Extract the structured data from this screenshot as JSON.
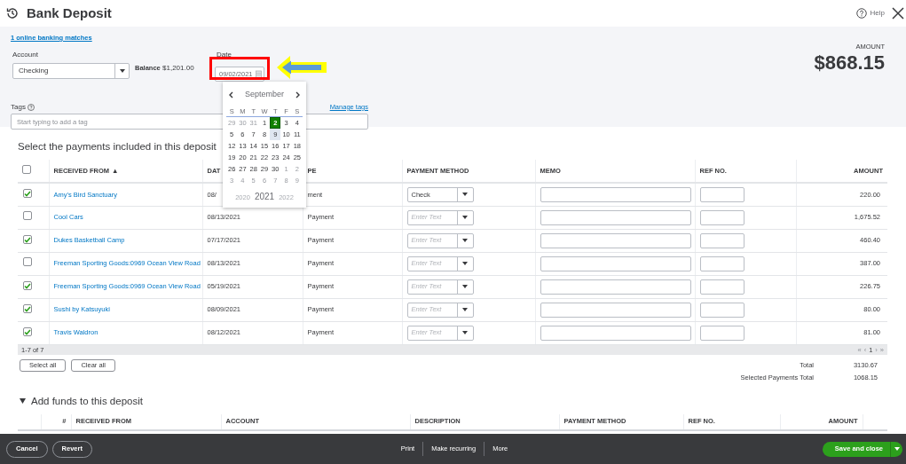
{
  "window": {
    "title": "Bank Deposit",
    "help": "Help"
  },
  "header": {
    "banking_matches": "1 online banking matches",
    "account": {
      "label": "Account",
      "value": "Checking"
    },
    "balance_label": "Balance",
    "balance_value": "$1,201.00",
    "date": {
      "label": "Date",
      "value": "09/02/2021"
    },
    "amount_label": "AMOUNT",
    "amount": "$868.15",
    "tags": {
      "label": "Tags",
      "placeholder": "Start typing to add a tag"
    },
    "manage_tags": "Manage tags"
  },
  "date_picker": {
    "month": "September",
    "weekdays": [
      "S",
      "M",
      "T",
      "W",
      "T",
      "F",
      "S"
    ],
    "weeks": [
      [
        {
          "day": "29",
          "muted": true,
          "selected": false,
          "highlighted": false
        },
        {
          "day": "30",
          "muted": true,
          "selected": false,
          "highlighted": false
        },
        {
          "day": "31",
          "muted": true,
          "selected": false,
          "highlighted": false
        },
        {
          "day": "1",
          "muted": false,
          "selected": false,
          "highlighted": false
        },
        {
          "day": "2",
          "muted": false,
          "selected": true,
          "highlighted": false
        },
        {
          "day": "3",
          "muted": false,
          "selected": false,
          "highlighted": false
        },
        {
          "day": "4",
          "muted": false,
          "selected": false,
          "highlighted": false
        }
      ],
      [
        {
          "day": "5",
          "muted": false,
          "selected": false,
          "highlighted": false
        },
        {
          "day": "6",
          "muted": false,
          "selected": false,
          "highlighted": false
        },
        {
          "day": "7",
          "muted": false,
          "selected": false,
          "highlighted": false
        },
        {
          "day": "8",
          "muted": false,
          "selected": false,
          "highlighted": false
        },
        {
          "day": "9",
          "muted": false,
          "selected": false,
          "highlighted": true
        },
        {
          "day": "10",
          "muted": false,
          "selected": false,
          "highlighted": false
        },
        {
          "day": "11",
          "muted": false,
          "selected": false,
          "highlighted": false
        }
      ],
      [
        {
          "day": "12",
          "muted": false,
          "selected": false,
          "highlighted": false
        },
        {
          "day": "13",
          "muted": false,
          "selected": false,
          "highlighted": false
        },
        {
          "day": "14",
          "muted": false,
          "selected": false,
          "highlighted": false
        },
        {
          "day": "15",
          "muted": false,
          "selected": false,
          "highlighted": false
        },
        {
          "day": "16",
          "muted": false,
          "selected": false,
          "highlighted": false
        },
        {
          "day": "17",
          "muted": false,
          "selected": false,
          "highlighted": false
        },
        {
          "day": "18",
          "muted": false,
          "selected": false,
          "highlighted": false
        }
      ],
      [
        {
          "day": "19",
          "muted": false,
          "selected": false,
          "highlighted": false
        },
        {
          "day": "20",
          "muted": false,
          "selected": false,
          "highlighted": false
        },
        {
          "day": "21",
          "muted": false,
          "selected": false,
          "highlighted": false
        },
        {
          "day": "22",
          "muted": false,
          "selected": false,
          "highlighted": false
        },
        {
          "day": "23",
          "muted": false,
          "selected": false,
          "highlighted": false
        },
        {
          "day": "24",
          "muted": false,
          "selected": false,
          "highlighted": false
        },
        {
          "day": "25",
          "muted": false,
          "selected": false,
          "highlighted": false
        }
      ],
      [
        {
          "day": "26",
          "muted": false,
          "selected": false,
          "highlighted": false
        },
        {
          "day": "27",
          "muted": false,
          "selected": false,
          "highlighted": false
        },
        {
          "day": "28",
          "muted": false,
          "selected": false,
          "highlighted": false
        },
        {
          "day": "29",
          "muted": false,
          "selected": false,
          "highlighted": false
        },
        {
          "day": "30",
          "muted": false,
          "selected": false,
          "highlighted": false
        },
        {
          "day": "1",
          "muted": true,
          "selected": false,
          "highlighted": false
        },
        {
          "day": "2",
          "muted": true,
          "selected": false,
          "highlighted": false
        }
      ],
      [
        {
          "day": "3",
          "muted": true,
          "selected": false,
          "highlighted": false
        },
        {
          "day": "4",
          "muted": true,
          "selected": false,
          "highlighted": false
        },
        {
          "day": "5",
          "muted": true,
          "selected": false,
          "highlighted": false
        },
        {
          "day": "6",
          "muted": true,
          "selected": false,
          "highlighted": false
        },
        {
          "day": "7",
          "muted": true,
          "selected": false,
          "highlighted": false
        },
        {
          "day": "8",
          "muted": true,
          "selected": false,
          "highlighted": false
        },
        {
          "day": "9",
          "muted": true,
          "selected": false,
          "highlighted": false
        }
      ]
    ],
    "years": [
      {
        "label": "2020",
        "selected": false
      },
      {
        "label": "2021",
        "selected": true
      },
      {
        "label": "2022",
        "selected": false
      }
    ]
  },
  "payments": {
    "title": "Select the payments included in this deposit",
    "all_checked": false,
    "columns": [
      {
        "label": "RECEIVED FROM",
        "sort_indicator": "▲"
      },
      {
        "label": "DAT"
      },
      {
        "label": "PE"
      },
      {
        "label": "PAYMENT METHOD"
      },
      {
        "label": "MEMO"
      },
      {
        "label": "REF NO."
      },
      {
        "label": "AMOUNT"
      }
    ],
    "rows": [
      {
        "checked": true,
        "received_from": "Amy's Bird Sanctuary",
        "date": "08/",
        "type": "ment",
        "payment_method": "Check",
        "amount": "220.00"
      },
      {
        "checked": false,
        "received_from": "Cool Cars",
        "date": "08/13/2021",
        "type": "Payment",
        "payment_method_placeholder": "Enter Text",
        "amount": "1,675.52"
      },
      {
        "checked": true,
        "received_from": "Dukes Basketball Camp",
        "date": "07/17/2021",
        "type": "Payment",
        "payment_method_placeholder": "Enter Text",
        "amount": "460.40"
      },
      {
        "checked": false,
        "received_from": "Freeman Sporting Goods:0969 Ocean View Road",
        "date": "08/13/2021",
        "type": "Payment",
        "payment_method_placeholder": "Enter Text",
        "amount": "387.00"
      },
      {
        "checked": true,
        "received_from": "Freeman Sporting Goods:0969 Ocean View Road",
        "date": "05/19/2021",
        "type": "Payment",
        "payment_method_placeholder": "Enter Text",
        "amount": "226.75"
      },
      {
        "checked": true,
        "received_from": "Sushi by Katsuyuki",
        "date": "08/09/2021",
        "type": "Payment",
        "payment_method_placeholder": "Enter Text",
        "amount": "80.00"
      },
      {
        "checked": true,
        "received_from": "Travis Waldron",
        "date": "08/12/2021",
        "type": "Payment",
        "payment_method_placeholder": "Enter Text",
        "amount": "81.00"
      }
    ],
    "pager": {
      "range": "1-7 of 7",
      "controls": [
        {
          "label": "«",
          "disabled": true
        },
        {
          "label": "‹",
          "disabled": true
        },
        {
          "label": "1",
          "disabled": false
        },
        {
          "label": "›",
          "disabled": true
        },
        {
          "label": "»",
          "disabled": true
        }
      ]
    },
    "buttons": [
      "Select all",
      "Clear all"
    ],
    "totals": [
      {
        "label": "Total",
        "value": "3130.67"
      },
      {
        "label": "Selected Payments Total",
        "value": "1068.15"
      }
    ]
  },
  "add_funds": {
    "title": "Add funds to this deposit",
    "expanded": true,
    "columns": [
      "#",
      "RECEIVED FROM",
      "ACCOUNT",
      "DESCRIPTION",
      "PAYMENT METHOD",
      "REF NO.",
      "AMOUNT"
    ]
  },
  "footer": {
    "left": [
      "Cancel",
      "Revert"
    ],
    "center": [
      "Print",
      "Make recurring",
      "More"
    ],
    "primary": "Save and close"
  }
}
